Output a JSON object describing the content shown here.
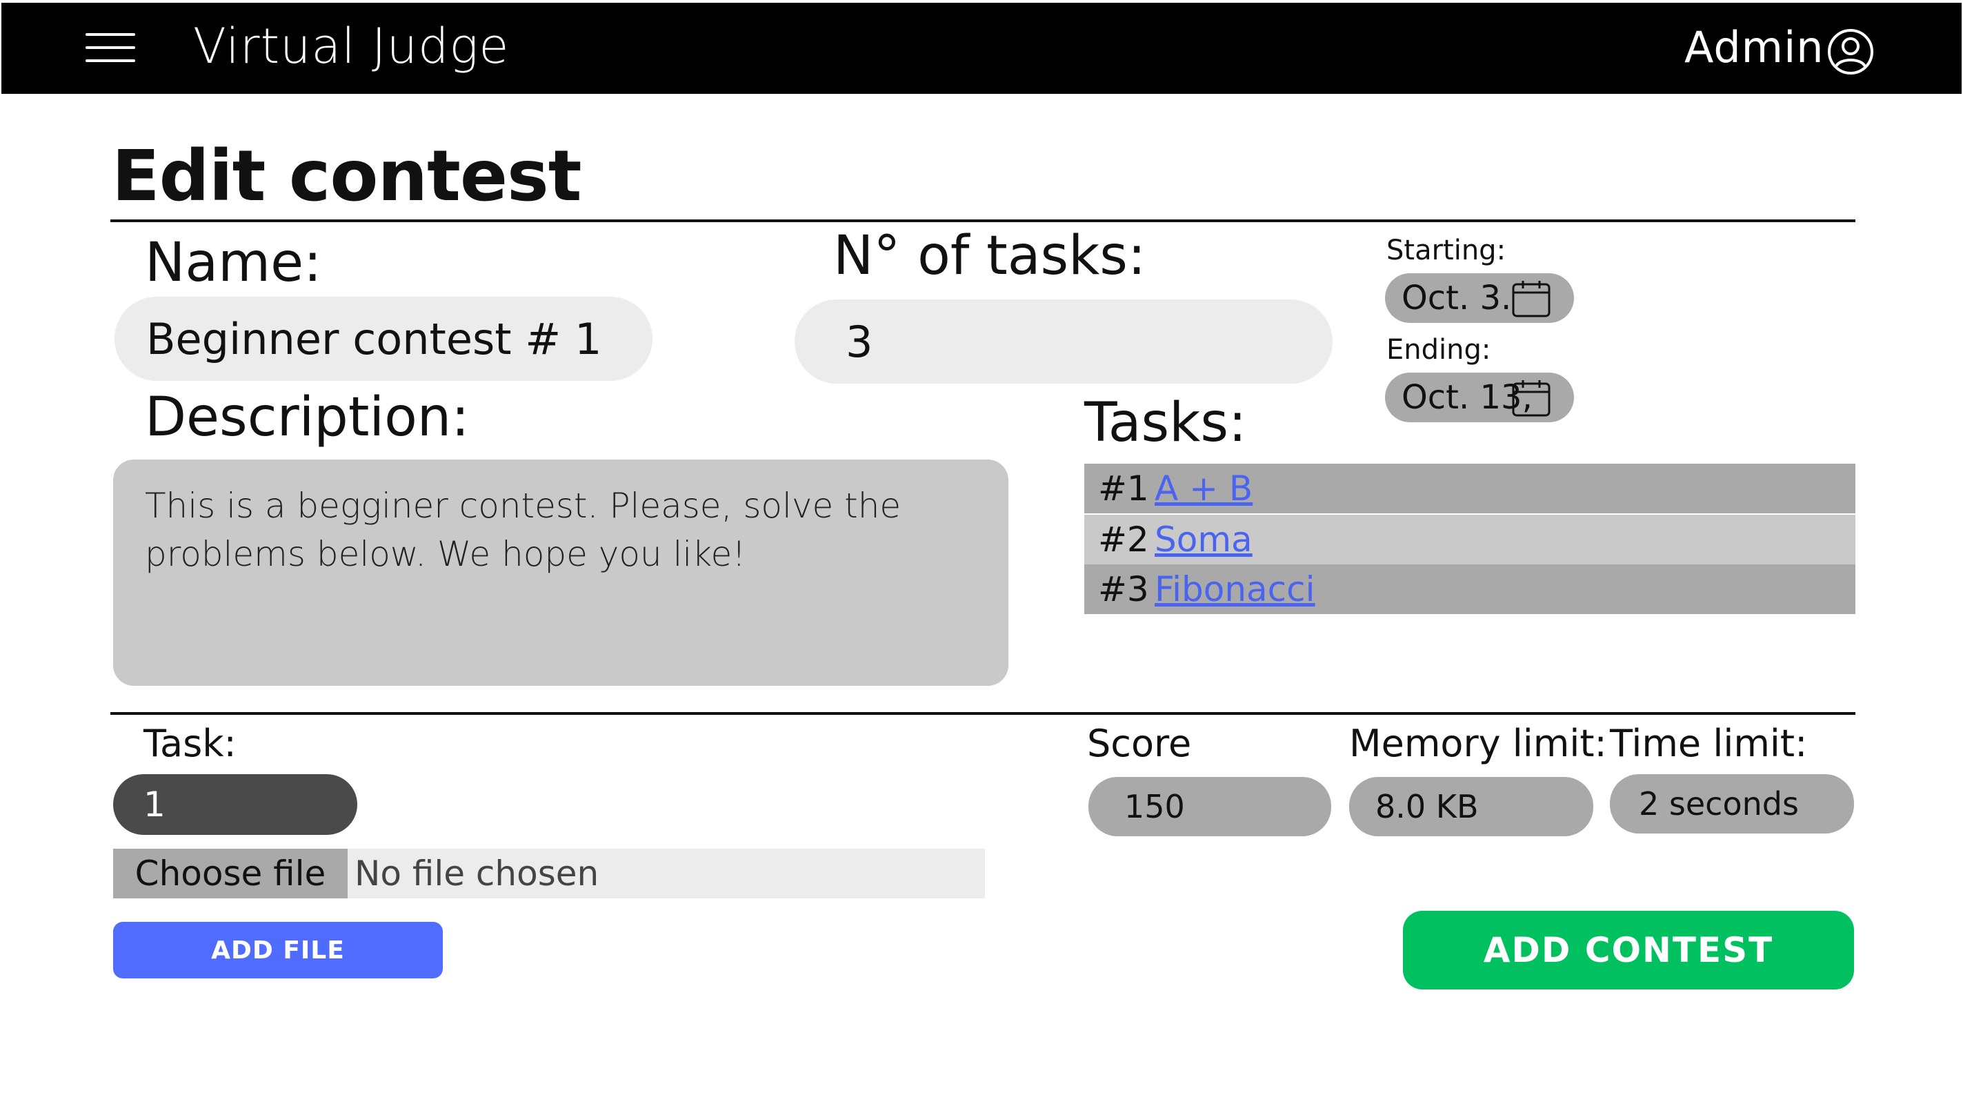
{
  "header": {
    "app_title": "Virtual Judge",
    "user_label": "Admin",
    "menu_icon": "hamburger-menu-icon",
    "user_icon": "user-circle-icon"
  },
  "page": {
    "title": "Edit contest"
  },
  "form": {
    "name_label": "Name:",
    "name_value": "Beginner contest # 1",
    "num_tasks_label": "N° of tasks:",
    "num_tasks_value": "3",
    "starting_label": "Starting:",
    "starting_value": "Oct. 3.",
    "ending_label": "Ending:",
    "ending_value": "Oct. 13,",
    "calendar_icon": "calendar-icon",
    "description_label": "Description:",
    "description_value": "This is a begginer contest. Please, solve the problems below. We hope you like!",
    "tasks_label": "Tasks:",
    "tasks": [
      {
        "num": "#1",
        "name": "A + B"
      },
      {
        "num": "#2",
        "name": "Soma"
      },
      {
        "num": "#3",
        "name": "Fibonacci"
      }
    ]
  },
  "task_editor": {
    "task_label": "Task:",
    "task_value": "1",
    "choose_file_label": "Choose file",
    "file_status": "No file chosen",
    "add_file_label": "ADD FILE",
    "score_label": "Score",
    "score_value": "150",
    "memory_label": "Memory limit:",
    "memory_value": "8.0 KB",
    "time_label": "Time limit:",
    "time_value": "2 seconds",
    "add_contest_label": "ADD CONTEST"
  },
  "colors": {
    "header_bg": "#000000",
    "input_light": "#ececec",
    "input_grey": "#a9a9a9",
    "description_bg": "#c9c9c9",
    "link": "#4a64f0",
    "add_file_button": "#4f6cff",
    "add_contest_button": "#00c060"
  }
}
